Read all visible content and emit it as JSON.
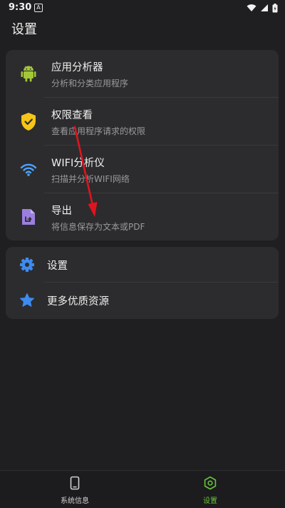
{
  "status_bar": {
    "time": "9:30",
    "notif_glyph": "A"
  },
  "header": {
    "title": "设置"
  },
  "menu_primary": [
    {
      "key": "app-analyzer",
      "icon": "android-icon",
      "title": "应用分析器",
      "subtitle": "分析和分类应用程序"
    },
    {
      "key": "permissions",
      "icon": "shield-check-icon",
      "title": "权限查看",
      "subtitle": "查看应用程序请求的权限"
    },
    {
      "key": "wifi-analyzer",
      "icon": "wifi-icon",
      "title": "WIFI分析仪",
      "subtitle": "扫描并分析WIFI网络"
    },
    {
      "key": "export",
      "icon": "export-file-icon",
      "title": "导出",
      "subtitle": "将信息保存为文本或PDF"
    }
  ],
  "menu_secondary": [
    {
      "key": "settings",
      "icon": "gear-icon",
      "title": "设置"
    },
    {
      "key": "more-resources",
      "icon": "star-icon",
      "title": "更多优质资源"
    }
  ],
  "bottom_nav": [
    {
      "key": "system-info",
      "icon": "phone-icon",
      "label": "系统信息",
      "active": false
    },
    {
      "key": "settings",
      "icon": "hexagon-gear-icon",
      "label": "设置",
      "active": true
    }
  ],
  "colors": {
    "background": "#1f1f21",
    "card": "#2c2c2e",
    "android_green": "#a4c639",
    "shield_yellow": "#f5c518",
    "wifi_blue": "#4aa3ff",
    "export_purple": "#9b7fe0",
    "accent_blue": "#3d8bf0",
    "active_green": "#67c23a",
    "arrow_red": "#e0141e"
  }
}
